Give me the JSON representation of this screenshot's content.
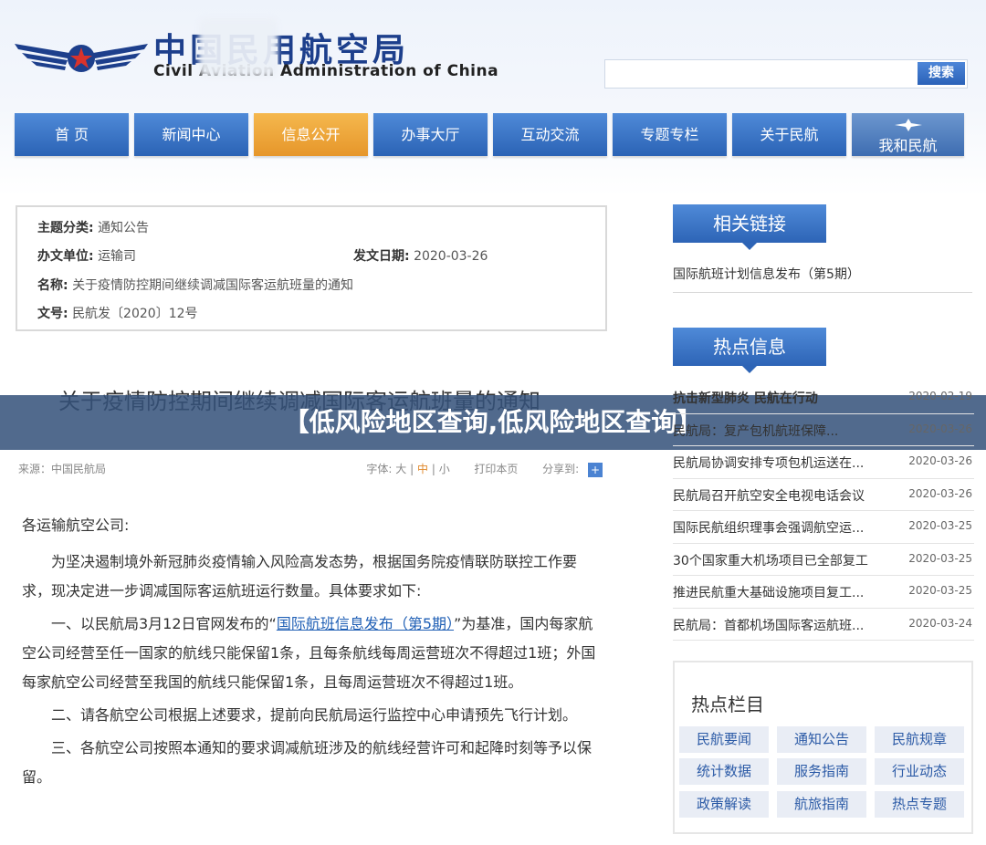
{
  "header": {
    "logo_cn": "中国民用航空局",
    "logo_en": "Civil Aviation Administration of China",
    "search_button": "搜索"
  },
  "nav": {
    "items": [
      {
        "label": "首 页"
      },
      {
        "label": "新闻中心"
      },
      {
        "label": "信息公开"
      },
      {
        "label": "办事大厅"
      },
      {
        "label": "互动交流"
      },
      {
        "label": "专题专栏"
      },
      {
        "label": "关于民航"
      },
      {
        "label": "我和民航"
      }
    ],
    "active_index": 2
  },
  "doc_info": {
    "category_label": "主题分类:",
    "category_value": "通知公告",
    "office_label": "办文单位:",
    "office_value": "运输司",
    "date_label": "发文日期:",
    "date_value": "2020-03-26",
    "name_label": "名称:",
    "name_value": "关于疫情防控期间继续调减国际客运航班量的通知",
    "number_label": "文号:",
    "number_value": "民航发〔2020〕12号"
  },
  "article": {
    "title": "关于疫情防控期间继续调减国际客运航班量的通知",
    "source": "来源：中国民航局",
    "font_label": "字体:",
    "font_large": "大",
    "font_medium": "中",
    "font_small": "小",
    "sep": "|",
    "print": "打印本页",
    "share": "分享到:",
    "share_icon": "+",
    "greeting": "各运输航空公司:",
    "p1": "为坚决遏制境外新冠肺炎疫情输入风险高发态势，根据国务院疫情联防联控工作要求，现决定进一步调减国际客运航班运行数量。具体要求如下:",
    "p2_pre": "一、以民航局3月12日官网发布的“",
    "p2_link": "国际航班信息发布（第5期）",
    "p2_post": "”为基准，国内每家航空公司经营至任一国家的航线只能保留1条，且每条航线每周运营班次不得超过1班；外国每家航空公司经营至我国的航线只能保留1条，且每周运营班次不得超过1班。",
    "p3": "二、请各航空公司根据上述要求，提前向民航局运行监控中心申请预先飞行计划。",
    "p4": "三、各航空公司按照本通知的要求调减航班涉及的航线经营许可和起降时刻等予以保留。"
  },
  "banner": {
    "text": "【低风险地区查询,低风险地区查询】"
  },
  "sidebar": {
    "related_title": "相关链接",
    "related_link": "国际航班计划信息发布（第5期）",
    "hot_title": "热点信息",
    "hot_items": [
      {
        "title": "抗击新型肺炎 民航在行动",
        "date": "2020-02-19"
      },
      {
        "title": "民航局：复产包机航班保障...",
        "date": "2020-03-26"
      },
      {
        "title": "民航局协调安排专项包机运送在...",
        "date": "2020-03-26"
      },
      {
        "title": "民航局召开航空安全电视电话会议",
        "date": "2020-03-26"
      },
      {
        "title": "国际民航组织理事会强调航空运...",
        "date": "2020-03-25"
      },
      {
        "title": "30个国家重大机场项目已全部复工",
        "date": "2020-03-25"
      },
      {
        "title": "推进民航重大基础设施项目复工...",
        "date": "2020-03-25"
      },
      {
        "title": "民航局：首都机场国际客运航班...",
        "date": "2020-03-24"
      }
    ],
    "columns_title": "热点栏目",
    "columns": [
      "民航要闻",
      "通知公告",
      "民航规章",
      "统计数据",
      "服务指南",
      "行业动态",
      "政策解读",
      "航旅指南",
      "热点专题"
    ]
  },
  "colors": {
    "nav_blue": "#2b63b5",
    "nav_active": "#e6962a",
    "banner_bg": "#34527a",
    "link": "#1f5fb5"
  }
}
